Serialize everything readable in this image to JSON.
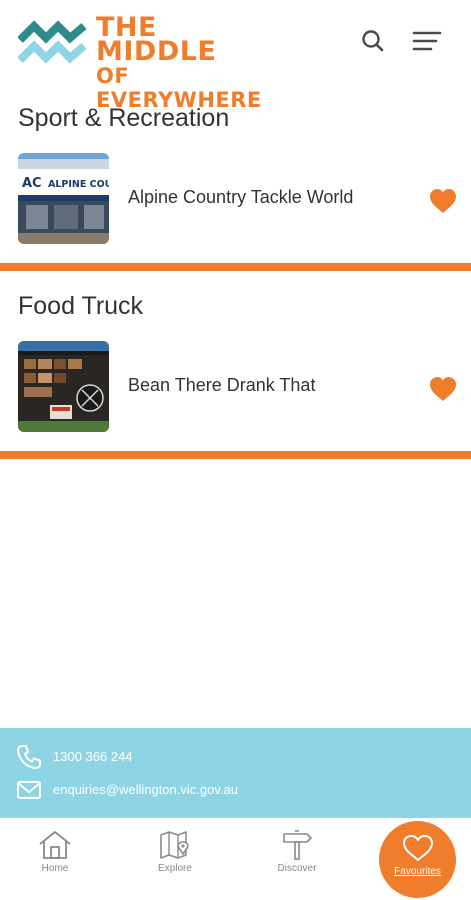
{
  "header": {
    "logo_line1": "THE MIDDLE",
    "logo_line2": "OF EVERYWHERE",
    "search_icon": "search-icon",
    "menu_icon": "hamburger-menu-icon"
  },
  "colors": {
    "accent": "#f07d2c",
    "logo_teal": "#2e8b8b",
    "logo_light_blue": "#8fd4e4",
    "contact_bg": "#8fd4e4",
    "text": "#333333"
  },
  "sections": [
    {
      "title": "Sport & Recreation",
      "items": [
        {
          "name": "Alpine Country Tackle World",
          "image_sign": "ALPINE COUN",
          "image_sign_mark": "AC",
          "favourite": true
        }
      ]
    },
    {
      "title": "Food Truck",
      "items": [
        {
          "name": "Bean There Drank That",
          "favourite": true
        }
      ]
    }
  ],
  "contact": {
    "phone": "1300 366 244",
    "email": "enquiries@wellington.vic.gov.au"
  },
  "nav": {
    "items": [
      {
        "label": "Home",
        "icon": "home-icon"
      },
      {
        "label": "Explore",
        "icon": "map-icon"
      },
      {
        "label": "Discover",
        "icon": "signpost-icon"
      },
      {
        "label": "Favourites",
        "icon": "heart-icon",
        "active": true
      }
    ]
  }
}
